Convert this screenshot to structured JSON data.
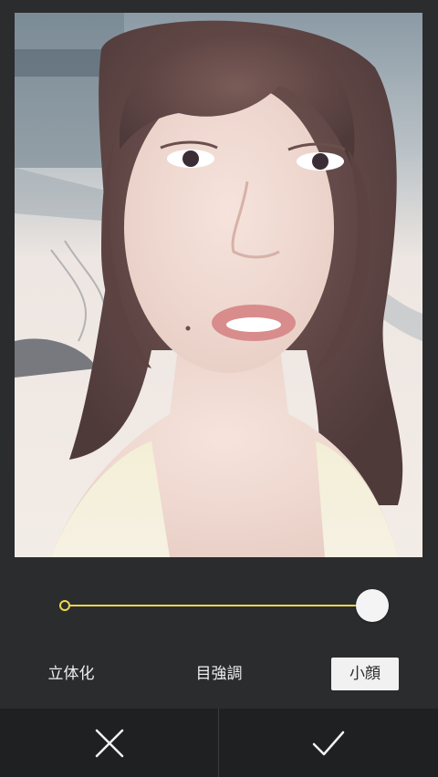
{
  "editor": {
    "photo": {
      "description_icon": "portrait-photo"
    },
    "slider": {
      "value": 1.0,
      "track_color": "#e8d84a",
      "thumb_color": "#f4f4f4"
    },
    "tabs": [
      {
        "label": "立体化",
        "selected": false
      },
      {
        "label": "目強調",
        "selected": false
      },
      {
        "label": "小顔",
        "selected": true
      }
    ],
    "actions": {
      "cancel_icon": "close-icon",
      "confirm_icon": "checkmark-icon"
    },
    "colors": {
      "background": "#2b2c2e",
      "bottom_bar": "#1f2022",
      "accent": "#e8d84a"
    }
  }
}
